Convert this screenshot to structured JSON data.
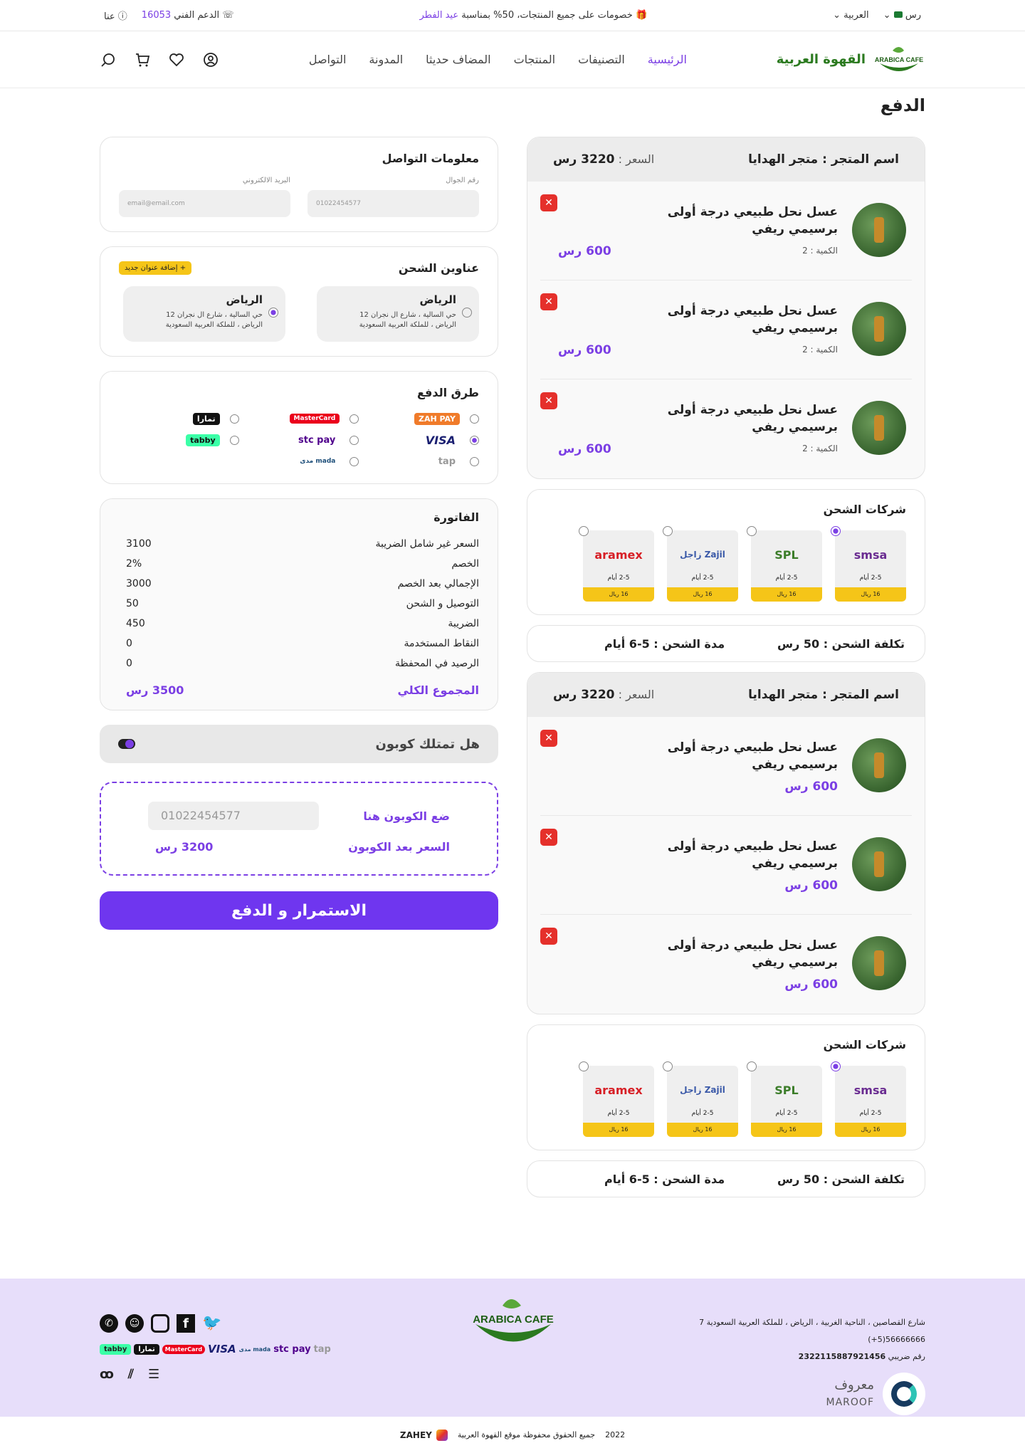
{
  "topbar": {
    "currency": "رس",
    "language": "العربية",
    "promo_text": "خصومات على جميع المنتجات، 50% بمناسبة",
    "promo_highlight": "عيد الفطر",
    "support_label": "الدعم الفني",
    "support_number": "16053",
    "about_label": "عنا"
  },
  "header": {
    "brand": "القهوة العربية",
    "logo_text": "ARABICA CAFE",
    "menu": [
      "الرئيسية",
      "التصنيفات",
      "المنتجات",
      "المضاف حديثا",
      "المدونة",
      "التواصل"
    ]
  },
  "page_title": "الدفع",
  "stores": [
    {
      "store_label": "اسم المتجر : متجر الهدايا",
      "price_label": "السعر :",
      "price_value": "3220 رس",
      "items": [
        {
          "name": "عسل نحل طبيعي درجة أولى برسيمي ريفي",
          "qty": "الكمية : 2",
          "price": "600 رس"
        },
        {
          "name": "عسل نحل طبيعي درجة أولى برسيمي ريفي",
          "qty": "الكمية : 2",
          "price": "600 رس"
        },
        {
          "name": "عسل نحل طبيعي درجة أولى برسيمي ريفي",
          "qty": "الكمية : 2",
          "price": "600 رس"
        }
      ],
      "shipping_title": "شركات الشحن",
      "carriers": [
        {
          "name": "smsa",
          "days": "2-5 أيام",
          "price": "16 ريال"
        },
        {
          "name": "SPL",
          "days": "2-5 أيام",
          "price": "16 ريال"
        },
        {
          "name": "Zajil زاجل",
          "days": "2-5 أيام",
          "price": "16 ريال"
        },
        {
          "name": "aramex",
          "days": "2-5 أيام",
          "price": "16 ريال"
        }
      ],
      "ship_cost": "تكلفة الشحن : 50 رس",
      "ship_time": "مدة الشحن : 5-6 أيام"
    },
    {
      "store_label": "اسم المتجر : متجر الهدايا",
      "price_label": "السعر :",
      "price_value": "3220 رس",
      "items": [
        {
          "name": "عسل نحل طبيعي درجة أولى برسيمي ريفي",
          "price": "600 رس"
        },
        {
          "name": "عسل نحل طبيعي درجة أولى برسيمي ريفي",
          "price": "600 رس"
        },
        {
          "name": "عسل نحل طبيعي درجة أولى برسيمي ريفي",
          "price": "600 رس"
        }
      ],
      "shipping_title": "شركات الشحن",
      "carriers": [
        {
          "name": "smsa",
          "days": "2-5 أيام",
          "price": "16 ريال"
        },
        {
          "name": "SPL",
          "days": "2-5 أيام",
          "price": "16 ريال"
        },
        {
          "name": "Zajil زاجل",
          "days": "2-5 أيام",
          "price": "16 ريال"
        },
        {
          "name": "aramex",
          "days": "2-5 أيام",
          "price": "16 ريال"
        }
      ],
      "ship_cost": "تكلفة الشحن : 50 رس",
      "ship_time": "مدة الشحن : 5-6 أيام"
    }
  ],
  "contact": {
    "title": "معلومات التواصل",
    "phone_label": "رقم الجوال",
    "phone_placeholder": "01022454577",
    "email_label": "البريد الالكتروني",
    "email_placeholder": "email@email.com"
  },
  "addresses": {
    "title": "عناوين الشحن",
    "add_label": "+ إضافة عنوان جديد",
    "list": [
      {
        "city": "الرياض",
        "line1": "حي السالية ، شارع ال نجران 12",
        "line2": "الرياض ، للملكة العربية السعودية"
      },
      {
        "city": "الرياض",
        "line1": "حي السالية ، شارع ال نجران 12",
        "line2": "الرياض ، للملكة العربية السعودية"
      }
    ]
  },
  "payment": {
    "title": "طرق الدفع",
    "methods": [
      "ZAH PAY",
      "MasterCard",
      "تمارا",
      "VISA",
      "stc pay",
      "tabby",
      "tap",
      "mada مدى"
    ]
  },
  "invoice": {
    "title": "الفاتورة",
    "rows": [
      {
        "label": "السعر غير شامل الضريبة",
        "value": "3100"
      },
      {
        "label": "الخصم",
        "value": "2%"
      },
      {
        "label": "الإجمالي بعد الخصم",
        "value": "3000"
      },
      {
        "label": "التوصيل و الشحن",
        "value": "50"
      },
      {
        "label": "الضريبة",
        "value": "450"
      },
      {
        "label": "النقاط المستخدمة",
        "value": "0"
      },
      {
        "label": "الرصيد في المحفظة",
        "value": "0"
      }
    ],
    "total_label": "المجموع الكلي",
    "total_value": "3500 رس"
  },
  "coupon": {
    "question": "هل تمتلك كوبون",
    "enter_label": "ضع الكوبون هنا",
    "input_placeholder": "01022454577",
    "after_label": "السعر بعد الكوبون",
    "after_value": "3200 رس"
  },
  "checkout_label": "الاستمرار و الدفع",
  "footer": {
    "address": "شارع القصاصين ، الناحية الغربية ، الرياض ، للملكة العربية السعودية 7",
    "phone": "(+5)56666666",
    "tax_label": "رقم ضريبي",
    "tax_number": "2322115887921456",
    "maroof_ar": "معروف",
    "maroof_en": "MAROOF",
    "logo_text": "ARABICA CAFE",
    "payments": [
      "tabby",
      "تمارا",
      "MasterCard",
      "VISA",
      "مدى mada",
      "stc pay",
      "tap"
    ],
    "copyright": "جميع الحقوق محفوظة موقع القهوة العربية",
    "year": "2022",
    "credit": "ZAHEY"
  },
  "colors": {
    "accent": "#7b3fe4",
    "button": "#6f36ef",
    "danger": "#e5302b",
    "yellow": "#f5c518",
    "footer_bg": "#e7defa"
  }
}
